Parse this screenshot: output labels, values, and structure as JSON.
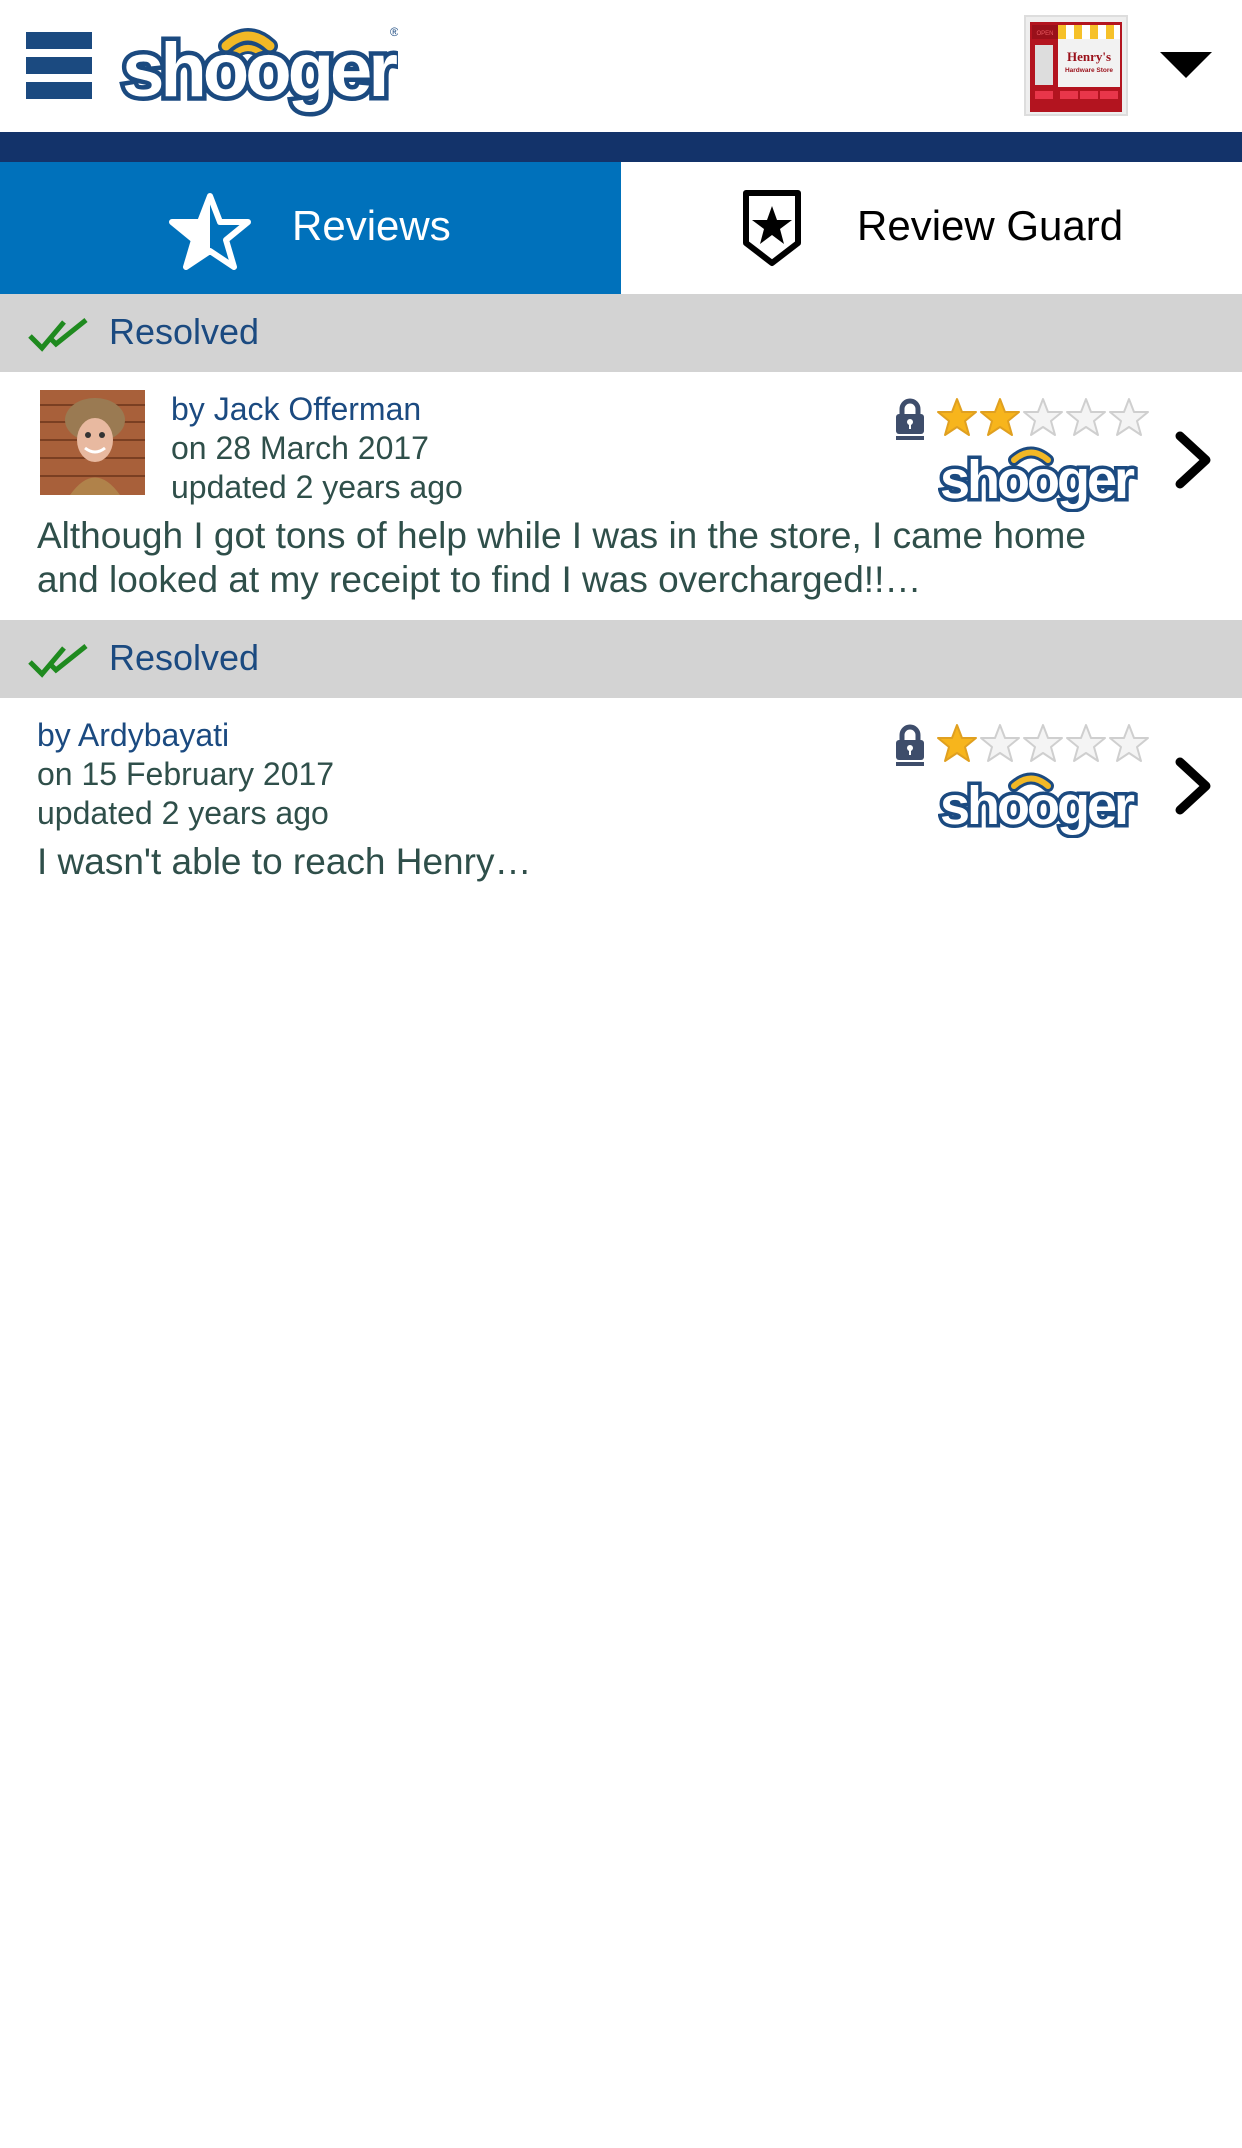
{
  "header": {
    "logo_text": "shooger",
    "store_name": "Henry's",
    "store_subtitle": "Hardware Store",
    "store_sign": "OPEN"
  },
  "tabs": [
    {
      "label": "Reviews",
      "icon": "half-star-icon",
      "active": true
    },
    {
      "label": "Review Guard",
      "icon": "shield-star-icon",
      "active": false
    }
  ],
  "colors": {
    "brand_navy": "#13336a",
    "tab_active": "#0071bb",
    "link_blue": "#1b4a80",
    "text_dark": "#2f4f4a",
    "status_bg": "#d3d3d3",
    "check_green": "#1f8a1f",
    "star_gold": "#f7b51c"
  },
  "reviews": [
    {
      "status": "Resolved",
      "author": "by Jack Offerman",
      "date": "on 28 March 2017",
      "updated": "updated 2 years ago",
      "text": "Although I got tons of help while I was in the store, I came home and looked at my receipt to find I was overcharged!!…",
      "rating": 2,
      "max_rating": 5,
      "source": "shooger",
      "has_avatar": true
    },
    {
      "status": "Resolved",
      "author": "by Ardybayati",
      "date": "on 15 February 2017",
      "updated": "updated 2 years ago",
      "text": "I wasn't able to reach Henry…",
      "rating": 1,
      "max_rating": 5,
      "source": "shooger",
      "has_avatar": false
    }
  ]
}
